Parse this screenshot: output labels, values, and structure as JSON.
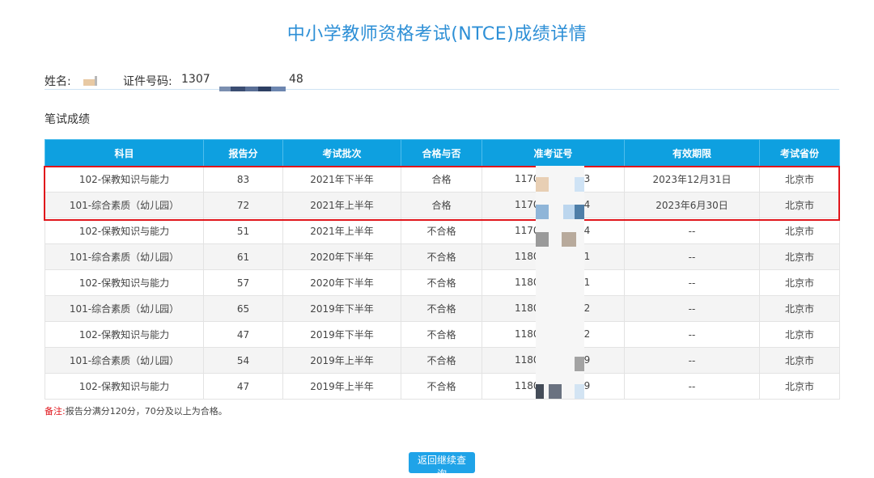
{
  "page_title": "中小学教师资格考试(NTCE)成绩详情",
  "candidate": {
    "name_label": "姓名:",
    "name_value": "",
    "id_label": "证件号码:",
    "id_prefix": "1307",
    "id_suffix": "48"
  },
  "section_title": "笔试成绩",
  "table": {
    "headers": [
      "科目",
      "报告分",
      "考试批次",
      "合格与否",
      "准考证号",
      "有效期限",
      "考试省份"
    ],
    "rows": [
      {
        "subject": "102-保教知识与能力",
        "score": "83",
        "batch": "2021年下半年",
        "pass": "合格",
        "ticket_prefix": "1170",
        "ticket_suffix": "73",
        "valid": "2023年12月31日",
        "province": "北京市"
      },
      {
        "subject": "101-综合素质（幼儿园）",
        "score": "72",
        "batch": "2021年上半年",
        "pass": "合格",
        "ticket_prefix": "1170",
        "ticket_suffix": "44",
        "valid": "2023年6月30日",
        "province": "北京市"
      },
      {
        "subject": "102-保教知识与能力",
        "score": "51",
        "batch": "2021年上半年",
        "pass": "不合格",
        "ticket_prefix": "1170",
        "ticket_suffix": "44",
        "valid": "--",
        "province": "北京市"
      },
      {
        "subject": "101-综合素质（幼儿园）",
        "score": "61",
        "batch": "2020年下半年",
        "pass": "不合格",
        "ticket_prefix": "1180",
        "ticket_suffix": "11",
        "valid": "--",
        "province": "北京市"
      },
      {
        "subject": "102-保教知识与能力",
        "score": "57",
        "batch": "2020年下半年",
        "pass": "不合格",
        "ticket_prefix": "1180",
        "ticket_suffix": "11",
        "valid": "--",
        "province": "北京市"
      },
      {
        "subject": "101-综合素质（幼儿园）",
        "score": "65",
        "batch": "2019年下半年",
        "pass": "不合格",
        "ticket_prefix": "1180",
        "ticket_suffix": "82",
        "valid": "--",
        "province": "北京市"
      },
      {
        "subject": "102-保教知识与能力",
        "score": "47",
        "batch": "2019年下半年",
        "pass": "不合格",
        "ticket_prefix": "1180",
        "ticket_suffix": "82",
        "valid": "--",
        "province": "北京市"
      },
      {
        "subject": "101-综合素质（幼儿园）",
        "score": "54",
        "batch": "2019年上半年",
        "pass": "不合格",
        "ticket_prefix": "1180",
        "ticket_suffix": "79",
        "valid": "--",
        "province": "北京市"
      },
      {
        "subject": "102-保教知识与能力",
        "score": "47",
        "batch": "2019年上半年",
        "pass": "不合格",
        "ticket_prefix": "1180",
        "ticket_suffix": "79",
        "valid": "--",
        "province": "北京市"
      }
    ]
  },
  "note": {
    "label": "备注:",
    "text": "报告分满分120分，70分及以上为合格。"
  },
  "return_button": "返回继续查询",
  "colors": {
    "title": "#2d8fd6",
    "header_bg": "#0ea0e0",
    "highlight": "#e0151b",
    "button": "#1fa3e8"
  }
}
